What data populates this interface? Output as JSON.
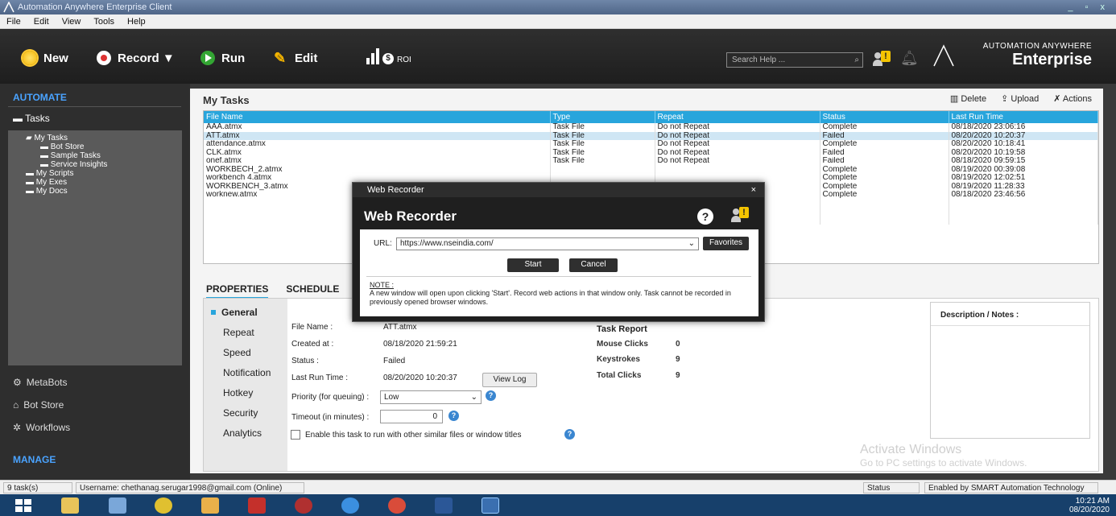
{
  "app": {
    "title": "Automation Anywhere Enterprise Client"
  },
  "menu": [
    "File",
    "Edit",
    "View",
    "Tools",
    "Help"
  ],
  "toolbar": {
    "new": "New",
    "record": "Record ▼",
    "run": "Run",
    "edit": "Edit",
    "roi": "ROI",
    "search_placeholder": "Search Help ...",
    "brand_line1": "AUTOMATION ANYWHERE",
    "brand_line2": "Enterprise"
  },
  "sidebar": {
    "automate": "AUTOMATE",
    "tasks": "Tasks",
    "tree": [
      "My Tasks",
      "Bot Store",
      "Sample Tasks",
      "Service Insights",
      "My Scripts",
      "My Exes",
      "My Docs"
    ],
    "metabots": "MetaBots",
    "botstore": "Bot Store",
    "workflows": "Workflows",
    "manage": "MANAGE"
  },
  "main": {
    "title": "My Tasks",
    "actions": {
      "delete": "Delete",
      "upload": "Upload",
      "actions": "Actions"
    },
    "columns": [
      "File Name",
      "Type",
      "Repeat",
      "Status",
      "Last Run Time"
    ],
    "rows": [
      [
        "AAA.atmx",
        "Task File",
        "Do not Repeat",
        "Complete",
        "08/18/2020 23:06:16"
      ],
      [
        "ATT.atmx",
        "Task File",
        "Do not Repeat",
        "Failed",
        "08/20/2020 10:20:37"
      ],
      [
        "attendance.atmx",
        "Task File",
        "Do not Repeat",
        "Complete",
        "08/20/2020 10:18:41"
      ],
      [
        "CLK.atmx",
        "Task File",
        "Do not Repeat",
        "Failed",
        "08/20/2020 10:19:58"
      ],
      [
        "onef.atmx",
        "Task File",
        "Do not Repeat",
        "Failed",
        "08/18/2020 09:59:15"
      ],
      [
        "WORKBECH_2.atmx",
        "",
        "",
        "Complete",
        "08/19/2020 00:39:08"
      ],
      [
        "workbench 4.atmx",
        "",
        "",
        "Complete",
        "08/19/2020 12:02:51"
      ],
      [
        "WORKBENCH_3.atmx",
        "",
        "",
        "Complete",
        "08/19/2020 11:28:33"
      ],
      [
        "worknew.atmx",
        "",
        "",
        "Complete",
        "08/18/2020 23:46:56"
      ]
    ],
    "tabs": [
      "PROPERTIES",
      "SCHEDULE"
    ],
    "prop_nav": [
      "General",
      "Repeat",
      "Speed",
      "Notification",
      "Hotkey",
      "Security",
      "Analytics"
    ],
    "general": {
      "file_name_label": "File Name :",
      "file_name": "ATT.atmx",
      "created_label": "Created at :",
      "created": "08/18/2020 21:59:21",
      "status_label": "Status :",
      "status": "Failed",
      "last_run_label": "Last Run Time :",
      "last_run": "08/20/2020 10:20:37",
      "view_log": "View Log",
      "priority_label": "Priority (for queuing) :",
      "priority": "Low",
      "timeout_label": "Timeout (in minutes) :",
      "timeout": "0",
      "enable_label": "Enable this task to run with other similar files or window titles"
    },
    "report": {
      "title": "Task Report",
      "mouse_clicks_label": "Mouse Clicks",
      "mouse_clicks": "0",
      "keystrokes_label": "Keystrokes",
      "keystrokes": "9",
      "total_clicks_label": "Total Clicks",
      "total_clicks": "9"
    },
    "notes_title": "Description / Notes :"
  },
  "dialog": {
    "titlebar": "Web Recorder",
    "heading": "Web Recorder",
    "url_label": "URL:",
    "url": "https://www.nseindia.com/",
    "favorites": "Favorites",
    "start": "Start",
    "cancel": "Cancel",
    "note_title": "NOTE :",
    "note_text": "A new window will open upon clicking 'Start'. Record web actions in that window only. Task cannot be recorded in previously opened browser windows."
  },
  "watermark": {
    "line1": "Activate Windows",
    "line2": "Go to PC settings to activate Windows."
  },
  "statusbar": {
    "count": "9 task(s)",
    "user": "Username: chethanag.serugar1998@gmail.com (Online)",
    "status": "Status",
    "enabled": "Enabled by SMART Automation Technology"
  },
  "taskbar": {
    "time": "10:21 AM",
    "date": "08/20/2020"
  },
  "colors": {
    "accent": "#28a5dc",
    "sidebar_head": "#4aa3ff",
    "dark": "#1e1e1e"
  }
}
